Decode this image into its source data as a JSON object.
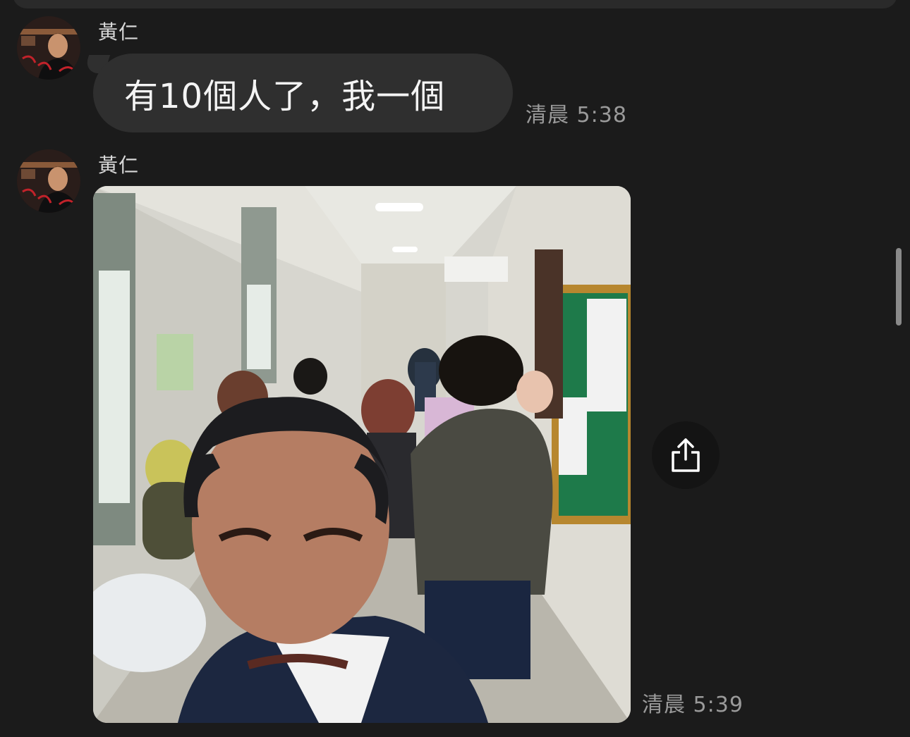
{
  "messages": [
    {
      "sender": "黃仁",
      "avatar_icon": "user-avatar",
      "type": "text",
      "text": "有10個人了，我一個",
      "time": "清晨 5:38"
    },
    {
      "sender": "黃仁",
      "avatar_icon": "user-avatar",
      "type": "image",
      "image_icon": "selfie-hallway-photo",
      "time": "清晨 5:39"
    }
  ],
  "actions": {
    "share_icon": "share-icon"
  },
  "colors": {
    "background": "#1b1b1b",
    "bubble": "#2f2f2f",
    "timestamp": "#9a9a9a",
    "name": "#d8d8d8"
  }
}
